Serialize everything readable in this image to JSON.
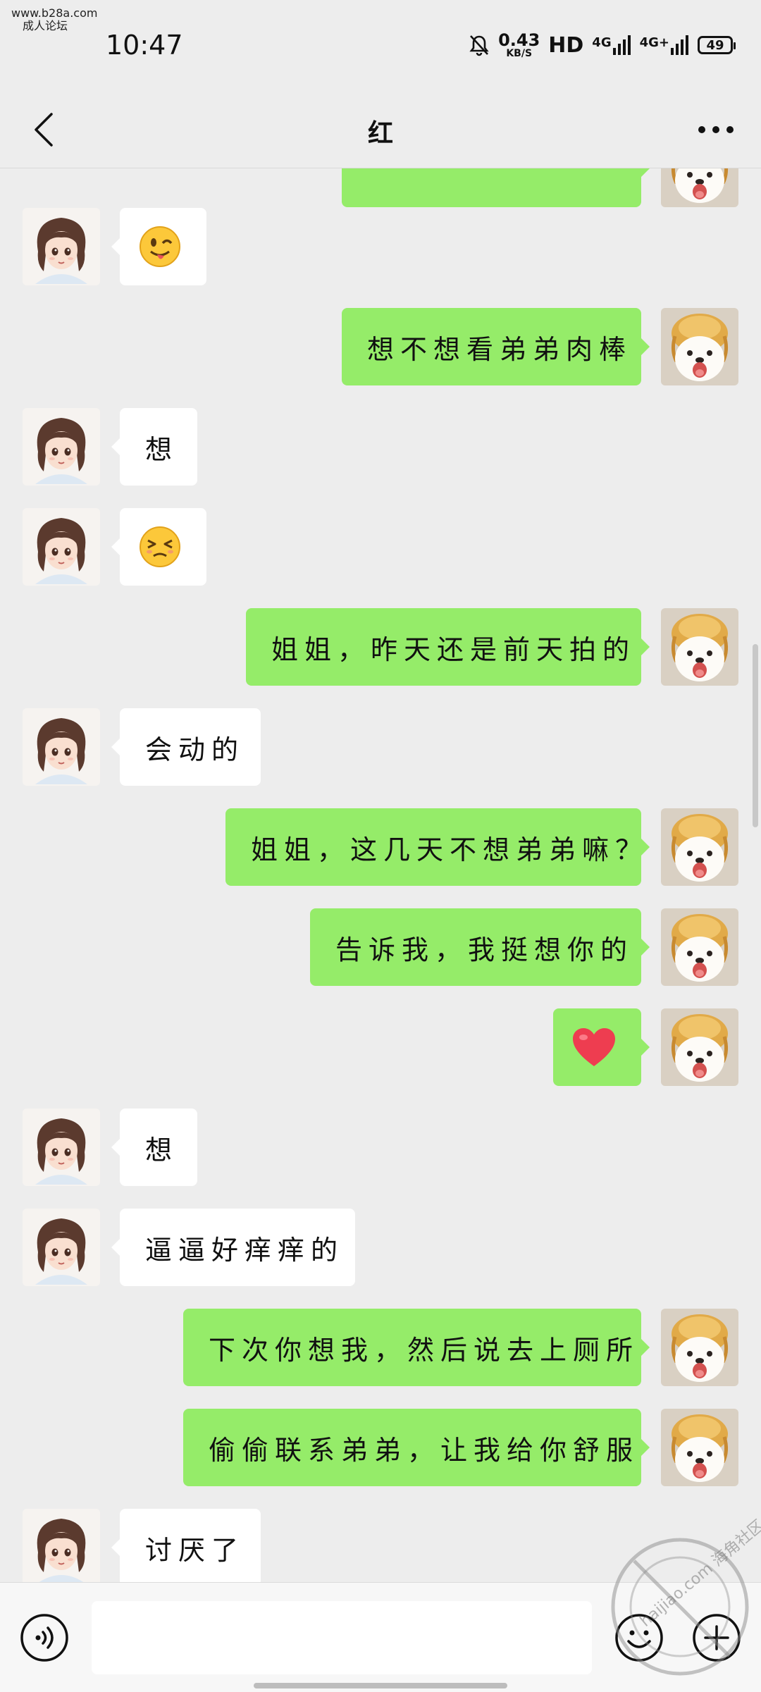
{
  "watermark": {
    "site": "www.b28a.com",
    "tagline": "成人论坛",
    "stamp_text": "haijiao.com",
    "stamp_label": "海角社区"
  },
  "status_bar": {
    "time": "10:47",
    "net_speed_value": "0.43",
    "net_speed_unit": "KB/S",
    "hd": "HD",
    "sim1": "4G",
    "sim2": "4G+",
    "battery": "49"
  },
  "header": {
    "title": "红",
    "back_icon": "chevron-left-icon",
    "more_icon": "more-dots-icon"
  },
  "messages": [
    {
      "side": "out",
      "type": "text",
      "text": "",
      "partial": true
    },
    {
      "side": "in",
      "type": "emoji",
      "emoji": "😜"
    },
    {
      "side": "out",
      "type": "text",
      "text": "想不想看弟弟肉棒"
    },
    {
      "side": "in",
      "type": "text",
      "text": "想"
    },
    {
      "side": "in",
      "type": "emoji",
      "emoji": "😣"
    },
    {
      "side": "out",
      "type": "text",
      "text": "姐姐，昨天还是前天拍的"
    },
    {
      "side": "in",
      "type": "text",
      "text": "会动的"
    },
    {
      "side": "out",
      "type": "text",
      "text": "姐姐，这几天不想弟弟嘛？"
    },
    {
      "side": "out",
      "type": "text",
      "text": "告诉我，我挺想你的"
    },
    {
      "side": "out",
      "type": "emoji",
      "emoji": "❤️"
    },
    {
      "side": "in",
      "type": "text",
      "text": "想"
    },
    {
      "side": "in",
      "type": "text",
      "text": "逼逼好痒痒的"
    },
    {
      "side": "out",
      "type": "text",
      "text": "下次你想我，然后说去上厕所"
    },
    {
      "side": "out",
      "type": "text",
      "text": "偷偷联系弟弟，让我给你舒服"
    },
    {
      "side": "in",
      "type": "text",
      "text": "讨厌了"
    }
  ],
  "input_bar": {
    "placeholder": "",
    "voice_icon": "voice-icon",
    "emoji_icon": "emoji-face-icon",
    "plus_icon": "plus-circle-icon"
  },
  "colors": {
    "background": "#ededed",
    "bubble_out": "#95ec69",
    "bubble_in": "#ffffff"
  }
}
